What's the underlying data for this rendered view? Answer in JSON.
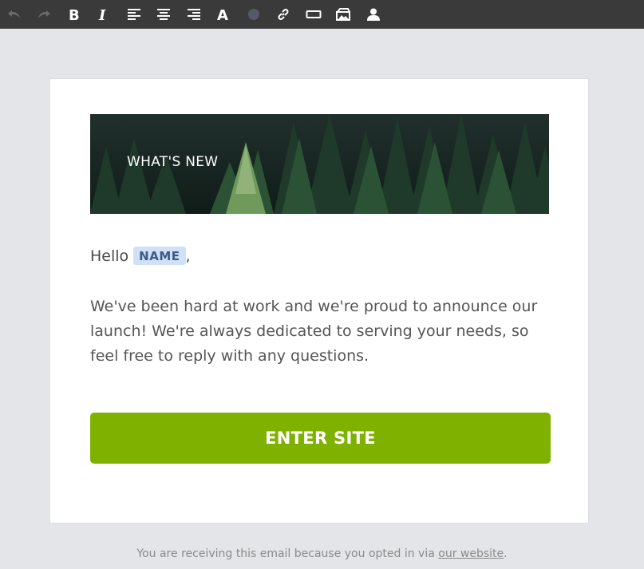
{
  "toolbar": {
    "buttons": [
      {
        "name": "undo-icon"
      },
      {
        "name": "redo-icon"
      },
      {
        "name": "bold-icon"
      },
      {
        "name": "italic-icon"
      },
      {
        "name": "align-left-icon"
      },
      {
        "name": "align-center-icon"
      },
      {
        "name": "align-right-icon"
      },
      {
        "name": "font-icon"
      },
      {
        "name": "color-icon"
      },
      {
        "name": "link-icon"
      },
      {
        "name": "button-icon"
      },
      {
        "name": "image-icon"
      },
      {
        "name": "user-icon"
      }
    ]
  },
  "hero": {
    "title": "WHAT'S NEW"
  },
  "email": {
    "greeting": "Hello",
    "merge_tag": "NAME",
    "greeting_suffix": ",",
    "body": "We've been hard at work and we're proud to announce our launch! We're always dedicated to serving your needs, so feel free to reply with any questions.",
    "cta_label": "ENTER SITE"
  },
  "footer": {
    "text": "You are receiving this email because you opted in via",
    "link_text": "our website",
    "suffix": "."
  },
  "colors": {
    "toolbar_bg": "#3a3a3a",
    "page_bg": "#e4e5e8",
    "cta_bg": "#7fb200",
    "merge_tag_bg": "#cfe0f7"
  }
}
